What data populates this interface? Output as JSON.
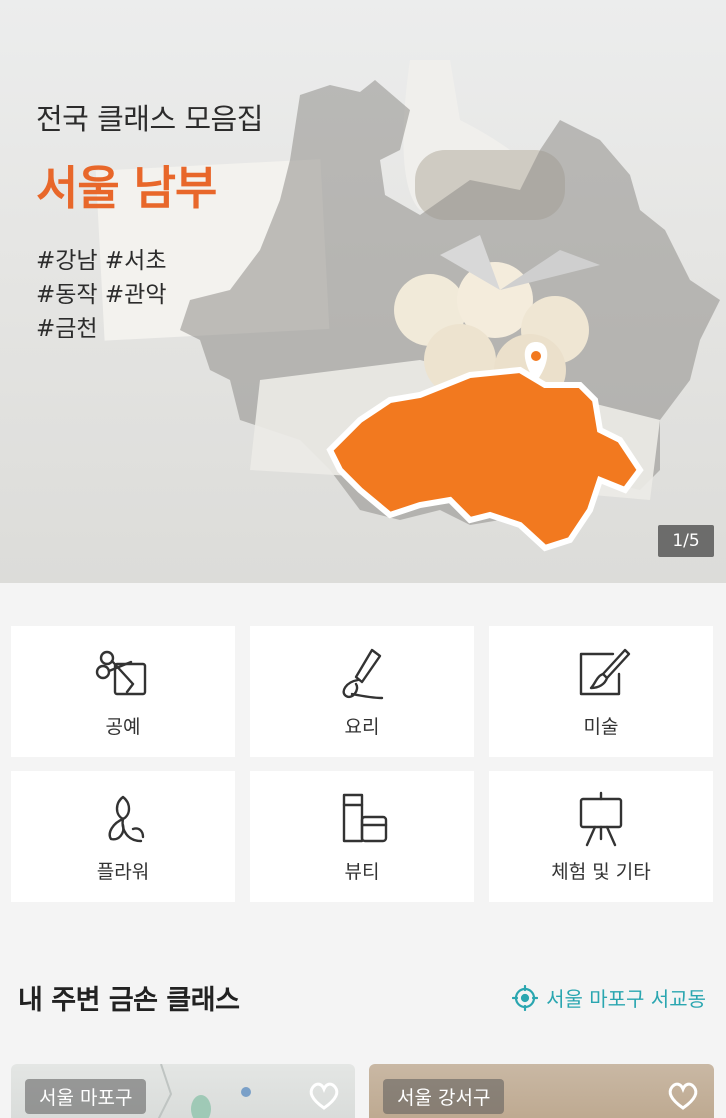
{
  "hero": {
    "subtitle": "전국 클래스 모음집",
    "title": "서울 남부",
    "tags": [
      "#강남 #서초",
      "#동작 #관악",
      "#금천"
    ],
    "pager": "1/5",
    "accent_color": "#e8672a"
  },
  "categories": [
    {
      "label": "공예",
      "icon": "craft-icon"
    },
    {
      "label": "요리",
      "icon": "cooking-icon"
    },
    {
      "label": "미술",
      "icon": "art-icon"
    },
    {
      "label": "플라워",
      "icon": "flower-icon"
    },
    {
      "label": "뷰티",
      "icon": "beauty-icon"
    },
    {
      "label": "체험 및 기타",
      "icon": "easel-icon"
    }
  ],
  "nearby": {
    "title": "내 주변 금손 클래스",
    "location": "서울 마포구 서교동",
    "location_color": "#2aa6b0",
    "cards": [
      {
        "region": "서울 마포구"
      },
      {
        "region": "서울 강서구"
      }
    ]
  }
}
